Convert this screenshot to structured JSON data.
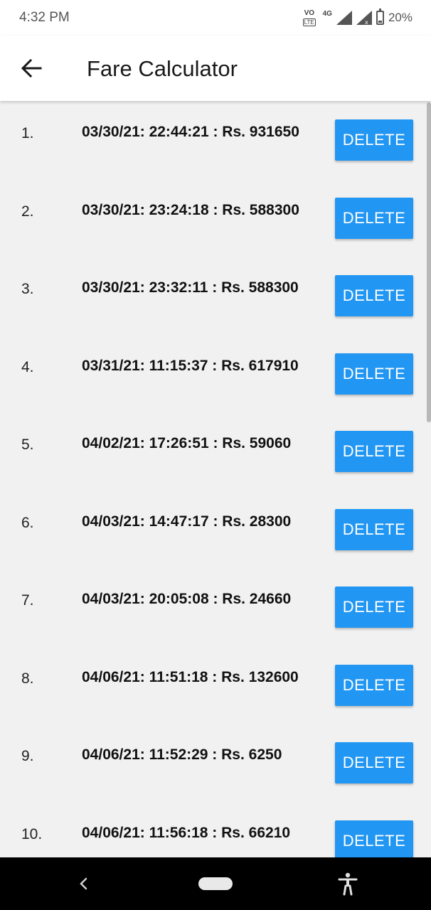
{
  "status_bar": {
    "time": "4:32 PM",
    "volte_top": "VO",
    "volte_bottom": "LTE",
    "network": "4G",
    "battery": "20%"
  },
  "app_bar": {
    "title": "Fare Calculator",
    "back_icon": "arrow-left-icon"
  },
  "list": {
    "delete_label": "DELETE",
    "accent_color": "#2196f3",
    "items": [
      {
        "index": "1.",
        "text": "03/30/21: 22:44:21 : Rs. 931650",
        "delete": "DELETE"
      },
      {
        "index": "2.",
        "text": "03/30/21: 23:24:18 : Rs. 588300",
        "delete": "DELETE"
      },
      {
        "index": "3.",
        "text": "03/30/21: 23:32:11 : Rs. 588300",
        "delete": "DELETE"
      },
      {
        "index": "4.",
        "text": "03/31/21: 11:15:37 : Rs. 617910",
        "delete": "DELETE"
      },
      {
        "index": "5.",
        "text": "04/02/21: 17:26:51 : Rs. 59060",
        "delete": "DELETE"
      },
      {
        "index": "6.",
        "text": "04/03/21: 14:47:17 : Rs. 28300",
        "delete": "DELETE"
      },
      {
        "index": "7.",
        "text": "04/03/21: 20:05:08 : Rs. 24660",
        "delete": "DELETE"
      },
      {
        "index": "8.",
        "text": "04/06/21: 11:51:18 : Rs. 132600",
        "delete": "DELETE"
      },
      {
        "index": "9.",
        "text": "04/06/21: 11:52:29 : Rs. 6250",
        "delete": "DELETE"
      },
      {
        "index": "10.",
        "text": "04/06/21: 11:56:18 : Rs. 66210",
        "delete": "DELETE"
      }
    ]
  },
  "nav_bar": {
    "icons": [
      "chevron-left-icon",
      "home-pill-icon",
      "accessibility-icon"
    ]
  }
}
